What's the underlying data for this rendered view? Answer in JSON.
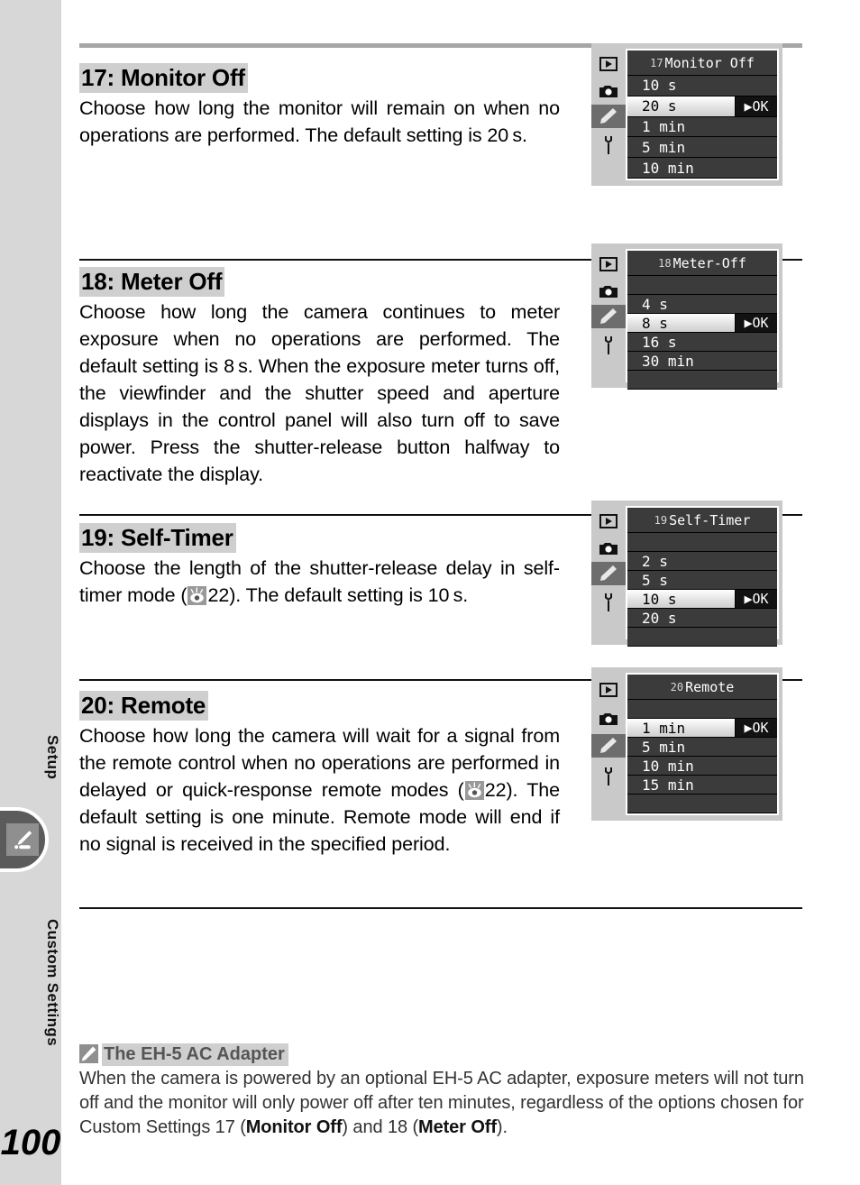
{
  "sidebar": {
    "label_setup": "Setup",
    "label_custom": "Custom Settings",
    "active_tab_icon": "pencil-icon",
    "page_number": "100"
  },
  "sections": [
    {
      "heading": "17: Monitor Off",
      "body": "Choose how long the monitor will remain on when no operations are performed.  The default setting is 20 s.",
      "lcd": {
        "number": "17",
        "title": "Monitor Off",
        "rows": [
          {
            "label": "10 s",
            "selected": false
          },
          {
            "label": "20 s",
            "selected": true,
            "ok": "▶OK"
          },
          {
            "label": "1 min",
            "selected": false
          },
          {
            "label": "5 min",
            "selected": false
          },
          {
            "label": "10 min",
            "selected": false
          }
        ]
      }
    },
    {
      "heading": "18: Meter Off",
      "body": "Choose how long the camera continues to meter exposure when no operations are performed.  The default setting is 8 s.  When the exposure meter turns off, the viewfinder and the shutter speed and aperture displays in the control panel will also turn off to save power.  Press the shutter-release button halfway to reactivate the display.",
      "lcd": {
        "number": "18",
        "title": "Meter-Off",
        "rows": [
          {
            "label": "",
            "selected": false,
            "spacer": true
          },
          {
            "label": "4 s",
            "selected": false
          },
          {
            "label": "8 s",
            "selected": true,
            "ok": "▶OK"
          },
          {
            "label": "16 s",
            "selected": false
          },
          {
            "label": "30 min",
            "selected": false
          },
          {
            "label": "",
            "selected": false,
            "spacer": true
          }
        ]
      }
    },
    {
      "heading": "19: Self-Timer",
      "body_before": "Choose the length of the shutter-release delay in self-timer mode (",
      "body_ref": "22",
      "body_after": ").  The default setting is 10 s.",
      "ref_icon": "self-timer-icon",
      "lcd": {
        "number": "19",
        "title": "Self-Timer",
        "rows": [
          {
            "label": "",
            "selected": false,
            "spacer": true
          },
          {
            "label": "2 s",
            "selected": false
          },
          {
            "label": "5 s",
            "selected": false
          },
          {
            "label": "10 s",
            "selected": true,
            "ok": "▶OK"
          },
          {
            "label": "20 s",
            "selected": false
          },
          {
            "label": "",
            "selected": false,
            "spacer": true
          }
        ]
      }
    },
    {
      "heading": "20: Remote",
      "body_before": "Choose how long the camera will wait for a signal from the remote control when no operations are performed in delayed or quick-response remote modes (",
      "body_ref": "22",
      "body_after": ").  The default setting is one minute. Remote mode will end if no signal is received in the specified period.",
      "ref_icon": "self-timer-icon",
      "lcd": {
        "number": "20",
        "title": "Remote",
        "rows": [
          {
            "label": "",
            "selected": false,
            "spacer": true
          },
          {
            "label": "1 min",
            "selected": true,
            "ok": "▶OK"
          },
          {
            "label": "5 min",
            "selected": false
          },
          {
            "label": "10 min",
            "selected": false
          },
          {
            "label": "15 min",
            "selected": false
          },
          {
            "label": "",
            "selected": false,
            "spacer": true
          }
        ]
      }
    }
  ],
  "lcd_side_icons": [
    "playback-icon",
    "camera-icon",
    "pencil-icon",
    "wrench-icon"
  ],
  "note": {
    "title": "The EH-5 AC Adapter",
    "icon": "pencil-icon",
    "text_1": "When the camera is powered by an optional EH-5 AC adapter, exposure meters will not turn off and the monitor will only power off after ten minutes, regardless of the options chosen for Custom Settings 17 (",
    "bold_1": "Monitor Off",
    "text_2": ") and 18 (",
    "bold_2": "Meter Off",
    "text_3": ")."
  },
  "colors": {
    "sidebar_bg": "#d7d7d7",
    "highlight": "#cfcfcf",
    "lcd_bg": "#3b3b3b",
    "tab_active": "#5b5b5b"
  }
}
